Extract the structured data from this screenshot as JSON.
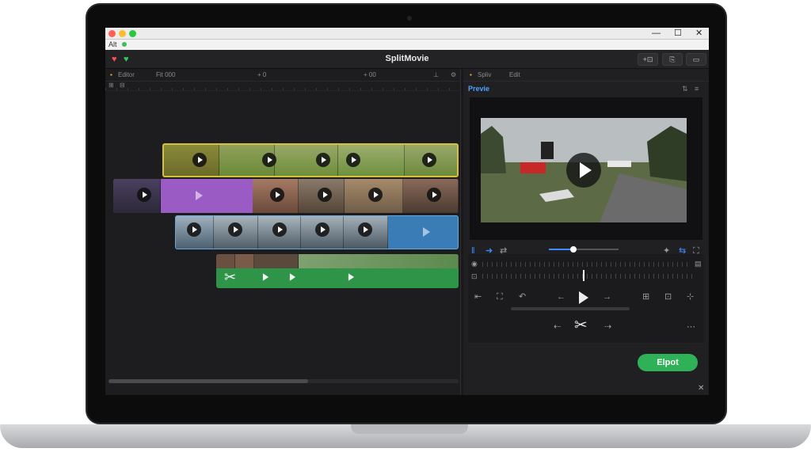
{
  "window": {
    "title": "SplitMovie",
    "subtitle": "Alt",
    "controls": {
      "minimize": "—",
      "maximize": "☐",
      "close": "✕"
    }
  },
  "toolbar": {
    "buttons": [
      {
        "icon": "share-icon",
        "label": "+⊡"
      },
      {
        "icon": "bookmark-icon",
        "label": "⎘"
      },
      {
        "icon": "comment-icon",
        "label": "▭"
      }
    ]
  },
  "timeline": {
    "tabs": [
      "Editor",
      "Fit 000"
    ],
    "markers": [
      "+ 0",
      "+ 00"
    ]
  },
  "preview": {
    "tabs": [
      "Spliv",
      "Edit"
    ],
    "heading": "Previe",
    "playhead_fraction": 0.35
  },
  "controls": {
    "row1": [
      "⇤",
      "⛶",
      "↶",
      "←",
      "→",
      "⊞",
      "⊡",
      "⊹"
    ],
    "row2": [
      "⇠",
      "⇢",
      "⋯"
    ]
  },
  "export": {
    "label": "Elpot"
  },
  "colors": {
    "accent": "#3b8cff",
    "export": "#2eb157",
    "track_yellow": "#b5a436",
    "track_purple": "#9b5bc4",
    "track_blue": "#3a7cb5",
    "track_green": "#2d9448"
  }
}
